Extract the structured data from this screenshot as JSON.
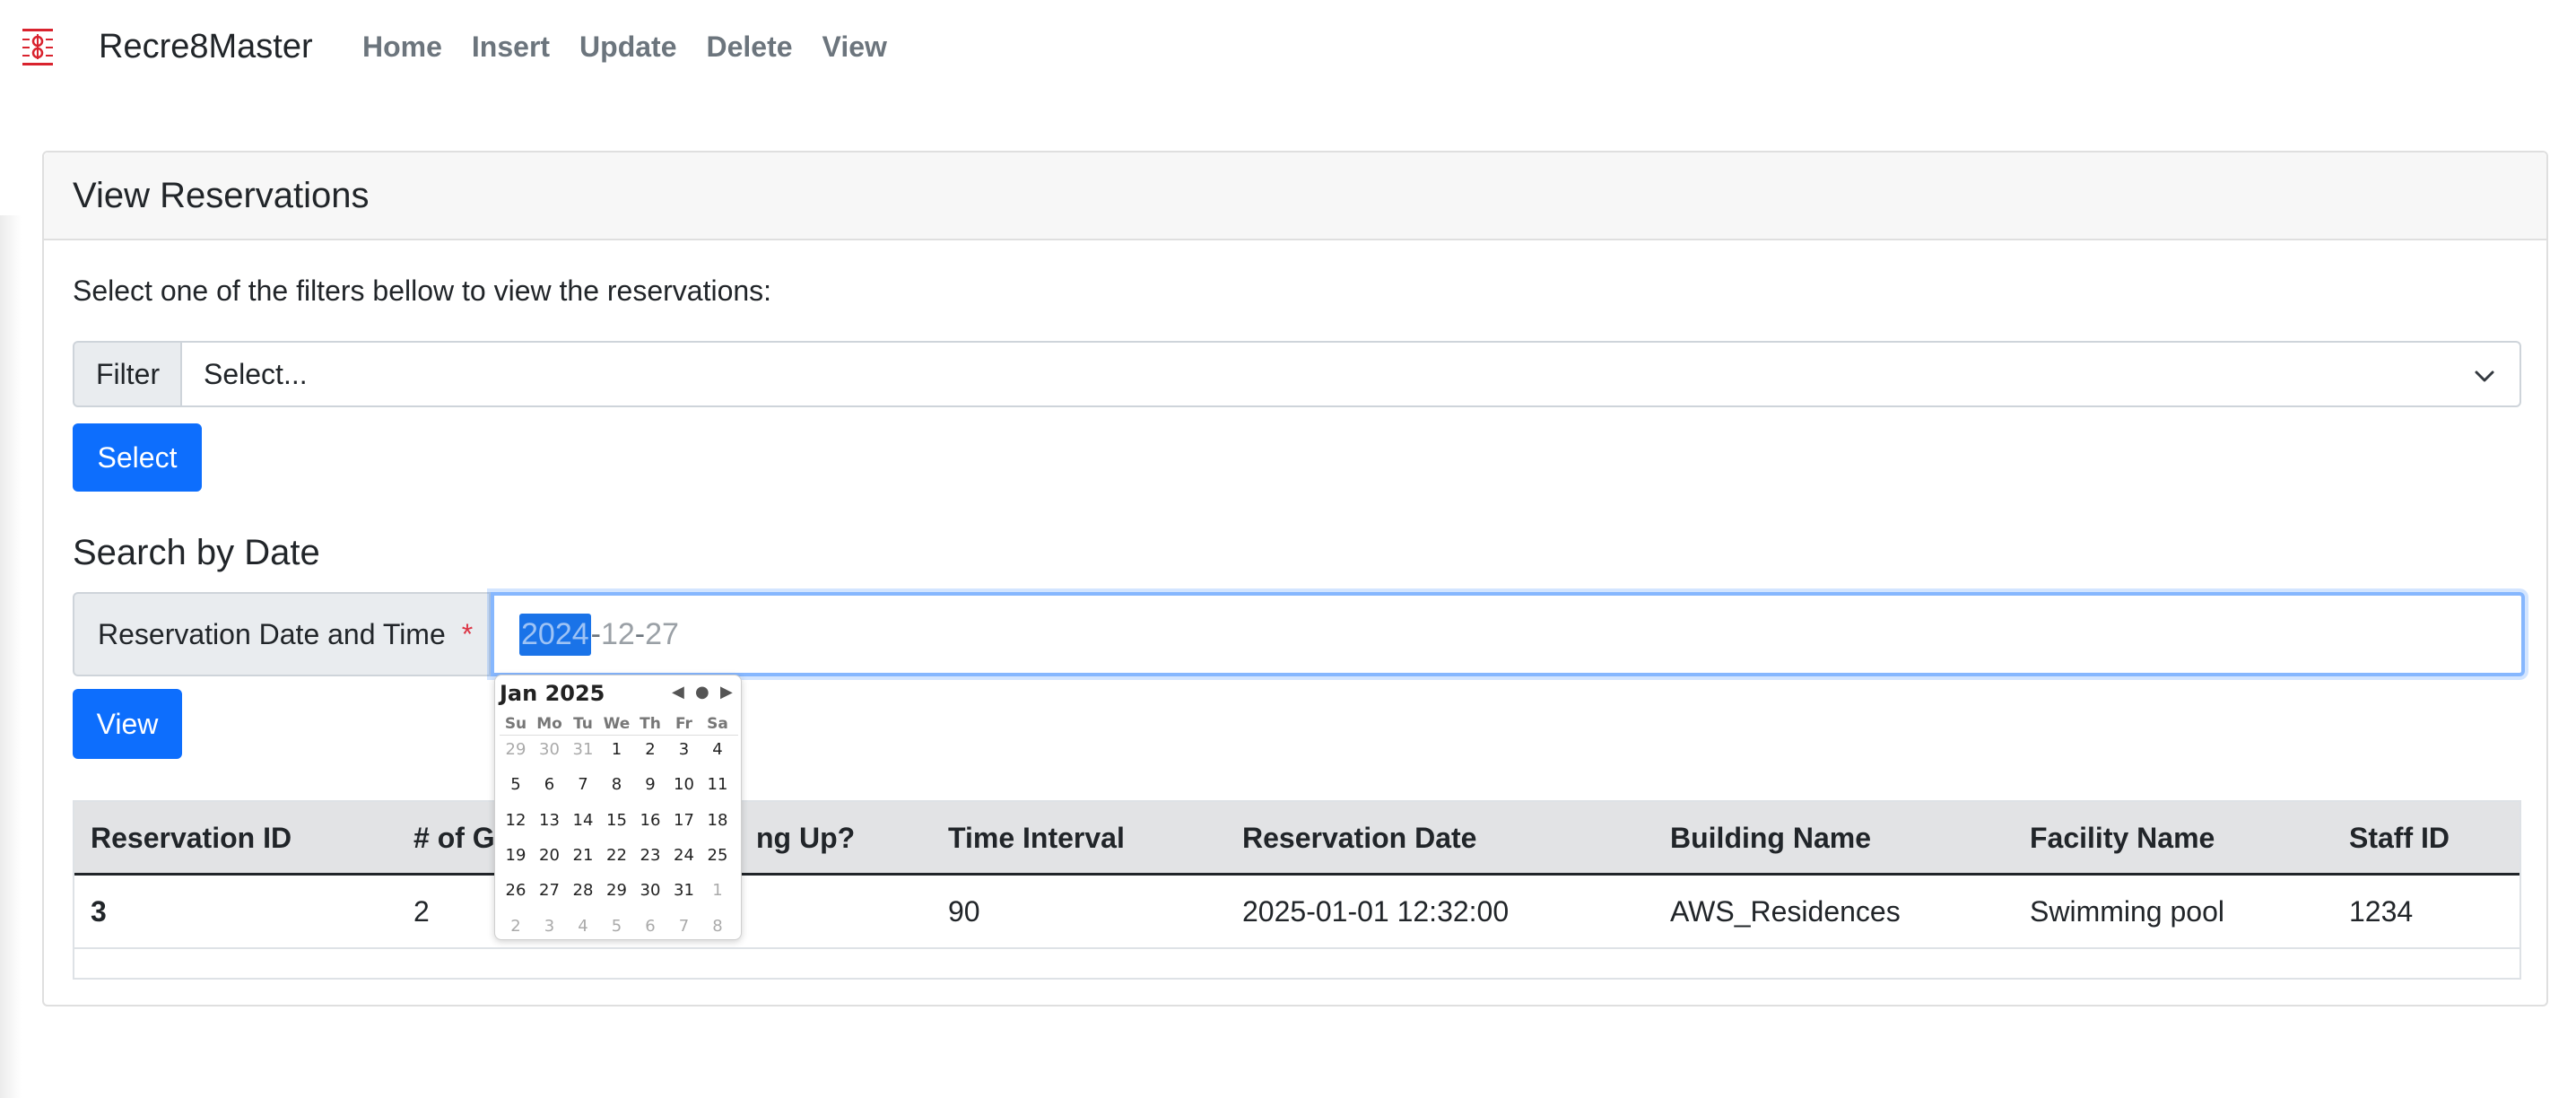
{
  "nav": {
    "brand": "Recre8Master",
    "links": [
      "Home",
      "Insert",
      "Update",
      "Delete",
      "View"
    ]
  },
  "card": {
    "title": "View Reservations",
    "intro": "Select one of the filters bellow to view the reservations:",
    "filter_label": "Filter",
    "filter_value": "Select...",
    "select_button": "Select",
    "search_heading": "Search by Date",
    "date_label": "Reservation Date and Time",
    "required_mark": "*",
    "date_year": "2024",
    "date_month": "12",
    "date_day": "27",
    "date_sep": "-",
    "view_button": "View"
  },
  "table": {
    "headers": [
      "Reservation ID",
      "# of Guests",
      "Setting Up?",
      "Time Interval",
      "Reservation Date",
      "Building Name",
      "Facility Name",
      "Staff ID"
    ],
    "visible_headers": [
      "Reservation ID",
      "# of G",
      "ng Up?",
      "Time Interval",
      "Reservation Date",
      "Building Name",
      "Facility Name",
      "Staff ID"
    ],
    "rows": [
      [
        "3",
        "2",
        "",
        "90",
        "2025-01-01 12:32:00",
        "AWS_Residences",
        "Swimming pool",
        "1234"
      ]
    ]
  },
  "calendar": {
    "month_label": "Jan 2025",
    "prev": "◀",
    "today": "●",
    "next": "▶",
    "weekdays": [
      "Su",
      "Mo",
      "Tu",
      "We",
      "Th",
      "Fr",
      "Sa"
    ],
    "weeks": [
      [
        "29",
        "30",
        "31",
        "1",
        "2",
        "3",
        "4"
      ],
      [
        "5",
        "6",
        "7",
        "8",
        "9",
        "10",
        "11"
      ],
      [
        "12",
        "13",
        "14",
        "15",
        "16",
        "17",
        "18"
      ],
      [
        "19",
        "20",
        "21",
        "22",
        "23",
        "24",
        "25"
      ],
      [
        "26",
        "27",
        "28",
        "29",
        "30",
        "31",
        "1"
      ],
      [
        "2",
        "3",
        "4",
        "5",
        "6",
        "7",
        "8"
      ]
    ],
    "muted_first_week_count": 3,
    "muted_after_index_row4": 6,
    "muted_last_row": true
  },
  "colors": {
    "primary": "#0d6efd",
    "brand_icon": "#d9232e",
    "focus_border": "#86b7fe",
    "required": "#dc3545"
  }
}
